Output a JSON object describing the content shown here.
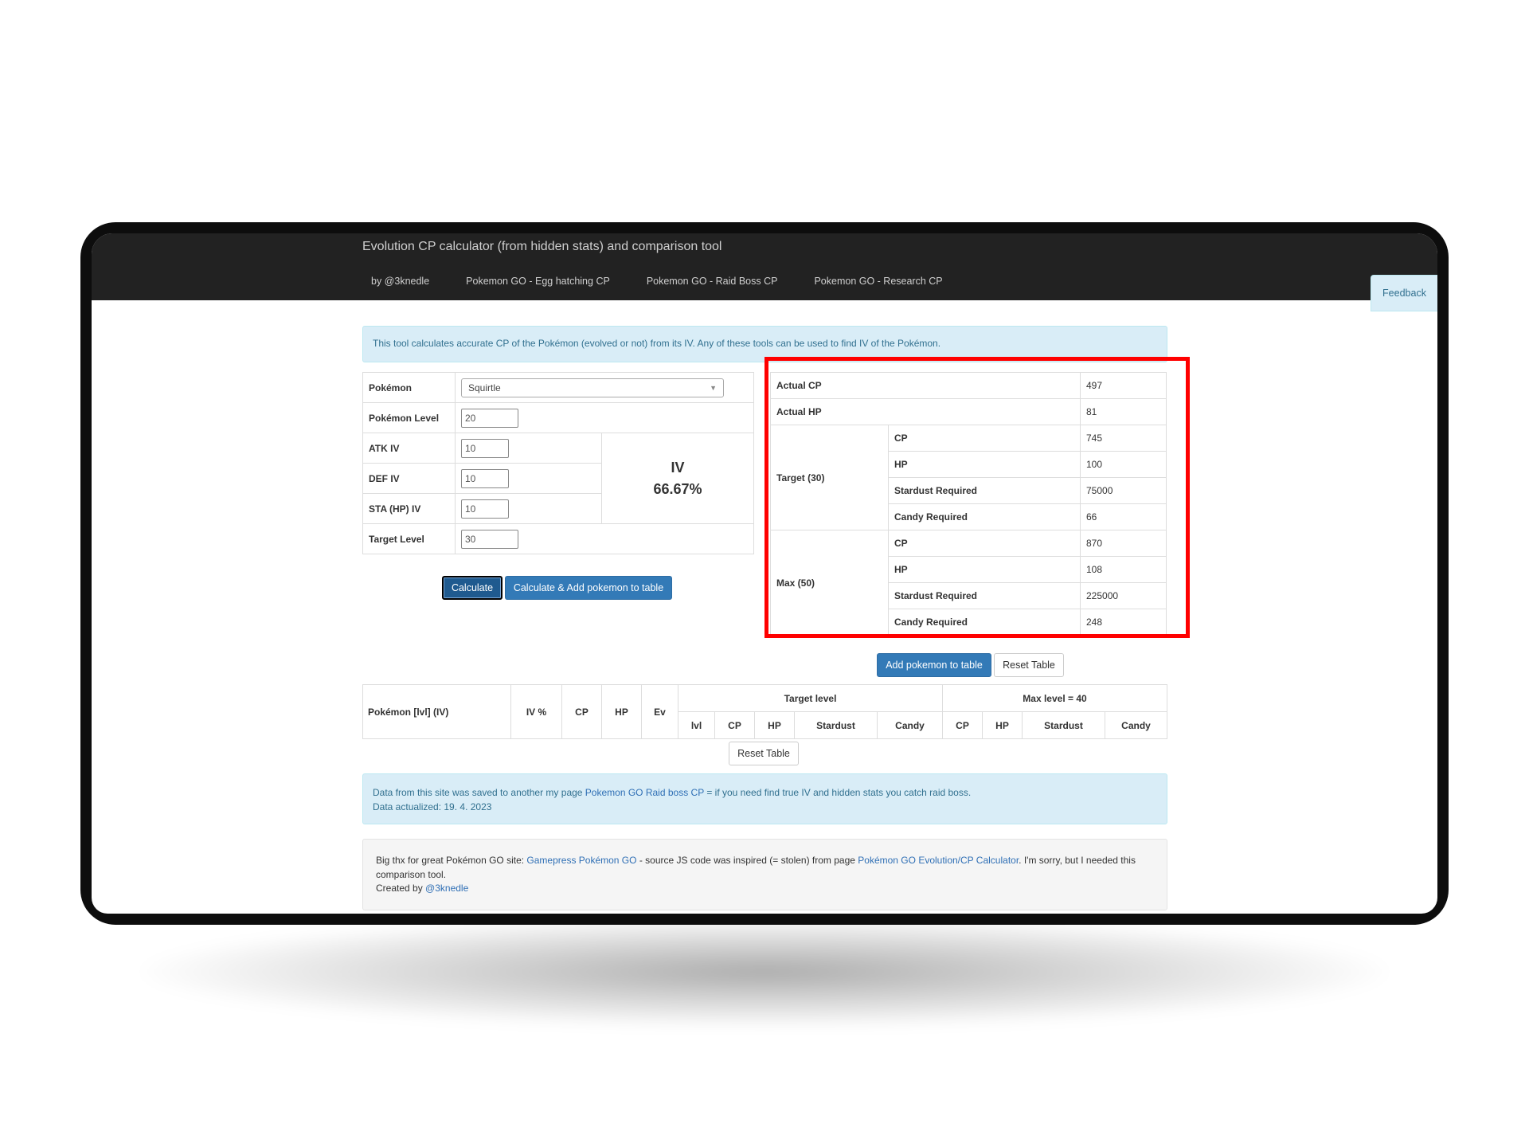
{
  "navbar": {
    "title": "Evolution CP calculator (from hidden stats) and comparison tool",
    "links": [
      "by @3knedle",
      "Pokemon GO - Egg hatching CP",
      "Pokemon GO - Raid Boss CP",
      "Pokemon GO - Research CP"
    ],
    "feedback": "Feedback"
  },
  "info_alert": "This tool calculates accurate CP of the Pokémon (evolved or not) from its IV. Any of these tools can be used to find IV of the Pokémon.",
  "form": {
    "pokemon_label": "Pokémon",
    "pokemon_value": "Squirtle",
    "level_label": "Pokémon Level",
    "level_value": "20",
    "atk_label": "ATK IV",
    "atk_value": "10",
    "def_label": "DEF IV",
    "def_value": "10",
    "sta_label": "STA (HP) IV",
    "sta_value": "10",
    "target_label": "Target Level",
    "target_value": "30",
    "iv_title": "IV",
    "iv_value": "66.67%"
  },
  "buttons": {
    "calculate": "Calculate",
    "calc_add": "Calculate & Add pokemon to table",
    "add_to_table": "Add pokemon to table",
    "reset_table": "Reset Table",
    "reset_table_2": "Reset Table"
  },
  "results": {
    "actual_cp_label": "Actual CP",
    "actual_cp": "497",
    "actual_hp_label": "Actual HP",
    "actual_hp": "81",
    "target_label": "Target (30)",
    "target": {
      "cp_label": "CP",
      "cp": "745",
      "hp_label": "HP",
      "hp": "100",
      "stardust_label": "Stardust Required",
      "stardust": "75000",
      "candy_label": "Candy Required",
      "candy": "66"
    },
    "max_label": "Max (50)",
    "max": {
      "cp_label": "CP",
      "cp": "870",
      "hp_label": "HP",
      "hp": "108",
      "stardust_label": "Stardust Required",
      "stardust": "225000",
      "candy_label": "Candy Required",
      "candy": "248"
    }
  },
  "compare": {
    "group_target": "Target level",
    "group_max": "Max level = 40",
    "col_pokemon": "Pokémon [lvl] (IV)",
    "col_iv": "IV %",
    "col_cp": "CP",
    "col_hp": "HP",
    "col_ev": "Ev",
    "t_lvl": "lvl",
    "t_cp": "CP",
    "t_hp": "HP",
    "t_stardust": "Stardust",
    "t_candy": "Candy",
    "m_cp": "CP",
    "m_hp": "HP",
    "m_stardust": "Stardust",
    "m_candy": "Candy"
  },
  "data_alert": {
    "line1_pre": "Data from this site was saved to another my page ",
    "line1_link": "Pokemon GO Raid boss CP",
    "line1_post": " = if you need find true IV and hidden stats you catch raid boss.",
    "line2": "Data actualized: 19. 4. 2023"
  },
  "footer": {
    "pre": "Big thx for great Pokémon GO site: ",
    "link1": "Gamepress Pokémon GO",
    "mid": " - source JS code was inspired (= stolen) from page ",
    "link2": "Pokémon GO Evolution/CP Calculator",
    "post": ". I'm sorry, but I needed this comparison tool.",
    "created_pre": "Created by ",
    "created_link": "@3knedle"
  },
  "colors": {
    "navbar": "#222222",
    "accent": "#337ab7",
    "highlight_box": "#ff0000",
    "alert_bg": "#d9edf7"
  }
}
